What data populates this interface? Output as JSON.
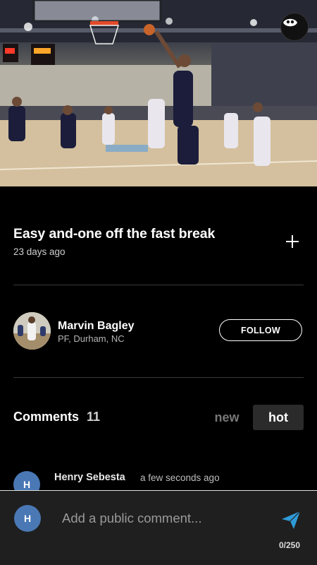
{
  "video": {
    "scene": "basketball-game-dunk",
    "logo_icon": "team-logo-icon"
  },
  "post": {
    "title": "Easy and-one off the fast break",
    "age": "23 days ago",
    "add_icon": "plus-icon"
  },
  "player": {
    "name": "Marvin Bagley",
    "info": "PF, Durham, NC",
    "follow_label": "FOLLOW"
  },
  "comments": {
    "label": "Comments",
    "count": "11",
    "tabs": [
      {
        "label": "new",
        "active": false
      },
      {
        "label": "hot",
        "active": true
      }
    ],
    "items": [
      {
        "avatar_initial": "H",
        "author": "Henry Sebesta",
        "time": "a few seconds ago"
      }
    ]
  },
  "compose": {
    "avatar_initial": "H",
    "placeholder": "Add a public comment...",
    "value": "",
    "char_count": "0/250",
    "send_icon": "send-icon"
  },
  "colors": {
    "background": "#000000",
    "avatar": "#4a78b5",
    "send": "#2f9bd8",
    "compose_bg": "#1f1f1f"
  }
}
